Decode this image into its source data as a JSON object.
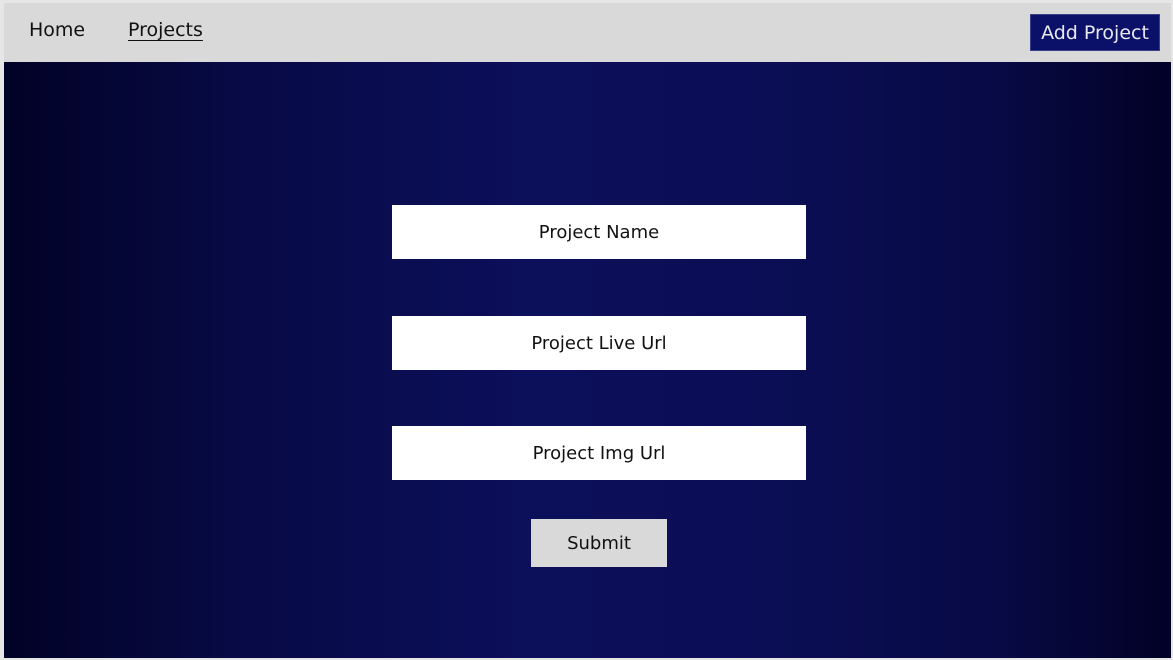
{
  "nav": {
    "home": "Home",
    "projects": "Projects",
    "add_project": "Add Project"
  },
  "form": {
    "project_name_placeholder": "Project Name",
    "project_live_url_placeholder": "Project Live Url",
    "project_img_url_placeholder": "Project Img Url",
    "submit": "Submit"
  },
  "colors": {
    "header_bg": "#d9d9d9",
    "accent": "#0b1068",
    "bg_center": "#0c0f5a",
    "bg_edge": "#020226"
  }
}
